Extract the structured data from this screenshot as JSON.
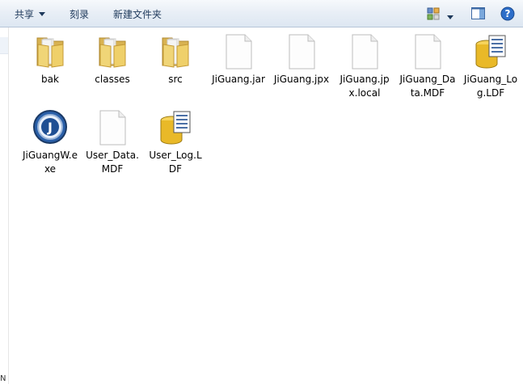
{
  "toolbar": {
    "share_label": "共享",
    "burn_label": "刻录",
    "new_folder_label": "新建文件夹"
  },
  "sidebar": {
    "fragment_text": "N"
  },
  "files": [
    {
      "name": "bak",
      "icon": "folder-icon"
    },
    {
      "name": "classes",
      "icon": "folder-icon"
    },
    {
      "name": "src",
      "icon": "folder-icon"
    },
    {
      "name": "JiGuang.jar",
      "icon": "blank-file-icon"
    },
    {
      "name": "JiGuang.jpx",
      "icon": "blank-file-icon"
    },
    {
      "name": "JiGuang.jpx.local",
      "icon": "blank-file-icon"
    },
    {
      "name": "JiGuang_Data.MDF",
      "icon": "blank-file-icon"
    },
    {
      "name": "JiGuang_Log.LDF",
      "icon": "database-log-icon"
    },
    {
      "name": "JiGuangW.exe",
      "icon": "jbuilder-app-icon"
    },
    {
      "name": "User_Data.MDF",
      "icon": "blank-file-icon"
    },
    {
      "name": "User_Log.LDF",
      "icon": "database-log-icon"
    }
  ]
}
